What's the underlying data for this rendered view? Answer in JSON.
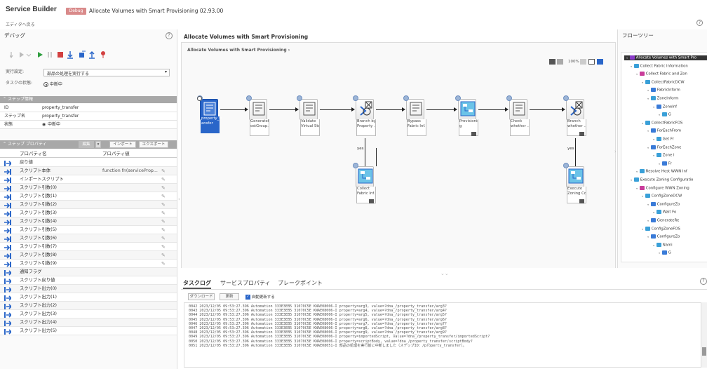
{
  "header": {
    "app_title": "Service Builder",
    "badge": "Debug",
    "title": "Allocate Volumes with Smart Provisioning 02.93.00",
    "back_link": "エディタへ戻る",
    "help": "?"
  },
  "left": {
    "title": "デバッグ",
    "help": "?",
    "exec_label": "実行設定:",
    "exec_value": "部品の処理を実行する",
    "status_label": "タスクの状態:",
    "status_value": "中断中",
    "step_section": "ステップ情報",
    "info": [
      {
        "k": "ID",
        "v": "property_transfer"
      },
      {
        "k": "ステップ名",
        "v": "property_transfer"
      },
      {
        "k": "状態",
        "v": "中断中"
      }
    ],
    "prop_section": "ステップ プロパティ",
    "prop_buttons": [
      "編集",
      "インポート",
      "エクスポート"
    ],
    "col_name": "プロパティ名",
    "col_value": "プロパティ値",
    "props": [
      {
        "n": "戻り値",
        "v": "",
        "icon": "out"
      },
      {
        "n": "スクリプト本体",
        "v": "function fn(serviceProp...",
        "icon": "in"
      },
      {
        "n": "インポートスクリプト",
        "v": "",
        "icon": "in"
      },
      {
        "n": "スクリプト引数(0)",
        "v": "",
        "icon": "in"
      },
      {
        "n": "スクリプト引数(1)",
        "v": "",
        "icon": "in"
      },
      {
        "n": "スクリプト引数(2)",
        "v": "",
        "icon": "in"
      },
      {
        "n": "スクリプト引数(3)",
        "v": "",
        "icon": "in"
      },
      {
        "n": "スクリプト引数(4)",
        "v": "",
        "icon": "in"
      },
      {
        "n": "スクリプト引数(5)",
        "v": "",
        "icon": "in"
      },
      {
        "n": "スクリプト引数(6)",
        "v": "",
        "icon": "in"
      },
      {
        "n": "スクリプト引数(7)",
        "v": "",
        "icon": "in"
      },
      {
        "n": "スクリプト引数(8)",
        "v": "",
        "icon": "in"
      },
      {
        "n": "スクリプト引数(9)",
        "v": "",
        "icon": "in"
      },
      {
        "n": "通知フラグ",
        "v": "",
        "icon": "out"
      },
      {
        "n": "スクリプト戻り値",
        "v": "",
        "icon": "out"
      },
      {
        "n": "スクリプト出力(0)",
        "v": "",
        "icon": "out"
      },
      {
        "n": "スクリプト出力(1)",
        "v": "",
        "icon": "out"
      },
      {
        "n": "スクリプト出力(2)",
        "v": "",
        "icon": "out"
      },
      {
        "n": "スクリプト出力(3)",
        "v": "",
        "icon": "out"
      },
      {
        "n": "スクリプト出力(4)",
        "v": "",
        "icon": "out"
      },
      {
        "n": "スクリプト出力(5)",
        "v": "",
        "icon": "out"
      }
    ]
  },
  "flow": {
    "title": "Allocate Volumes with Smart Provisioning",
    "breadcrumb": "Allocate Volumes with Smart Provisioning",
    "zoom": "100%",
    "nodes": [
      "property_tr\nansfer",
      "GenerateH\nostGroup...",
      "Validate\nVirtual Sto...",
      "Branch by\nProperty ...",
      "Bypass\nFabric Inf...",
      "Provisionin\ng",
      "Check\nwhether ...",
      "Branch\nwhether ..."
    ],
    "sub_nodes": [
      "Collect\nFabric Inf...",
      "Execute\nZoning Co..."
    ],
    "yes": "yes"
  },
  "tabs": {
    "items": [
      "タスクログ",
      "サービスプロパティ",
      "ブレークポイント"
    ],
    "download": "ダウンロード",
    "refresh": "更新",
    "auto_refresh": "自動更新する",
    "logs": [
      "0042 2023/12/05 09:53:27.396   Automation   333E3EB5 31070C5E KNAE08006-I     property=arg3, value=?dna_/property_transfer/arg3?",
      "0043 2023/12/05 09:53:27.396   Automation   333E3EB5 31070C5E KNAE08006-I     property=arg4, value=?dna_/property_transfer/arg4?",
      "0044 2023/12/05 09:53:27.396   Automation   333E3EB5 31070C5E KNAE08006-I     property=arg5, value=?dna_/property_transfer/arg5?",
      "0045 2023/12/05 09:53:27.396   Automation   333E3EB5 31070C5E KNAE08006-I     property=arg6, value=?dna_/property_transfer/arg6?",
      "0046 2023/12/05 09:53:27.396   Automation   333E3EB5 31070C5E KNAE08006-I     property=arg7, value=?dna_/property_transfer/arg7?",
      "0047 2023/12/05 09:53:27.396   Automation   333E3EB5 31070C5E KNAE08006-I     property=arg8, value=?dna_/property_transfer/arg8?",
      "0048 2023/12/05 09:53:27.396   Automation   333E3EB5 31070C5E KNAE08006-I     property=arg9, value=?dna_/property_transfer/arg9?",
      "0049 2023/12/05 09:53:27.396   Automation   333E3EB5 31070C5E KNAE08006-I     property=importedScript, value=?dna_/property_transfer/importedScript?",
      "0050 2023/12/05 09:53:27.396   Automation   333E3EB5 31070C5E KNAE08006-I     property=scriptBody, value=?dna_/property_transfer/scriptBody?",
      "0051 2023/12/05 09:53:27.396   Automation   333E3EB5 31070C5E KNAE08051-I     部品の処理を実行前に中断しました（ステップID：/property_transfer）。"
    ]
  },
  "tree": {
    "title": "フローツリー",
    "items": [
      {
        "t": "Allocate Volumes with Smart Pro",
        "d": 0,
        "c": "#8a3cc9",
        "sel": true
      },
      {
        "t": "Collect Fabric Information",
        "d": 1,
        "c": "#3aa0d8"
      },
      {
        "t": "Collect Fabric and Zon",
        "d": 2,
        "c": "#c93c9a"
      },
      {
        "t": "CollectFabricDCW",
        "d": 3,
        "c": "#3aa0d8"
      },
      {
        "t": "FabricInform",
        "d": 4,
        "c": "#3a7bd8"
      },
      {
        "t": "ZoneInform",
        "d": 4,
        "c": "#3aa0d8"
      },
      {
        "t": "ZoneInf",
        "d": 5,
        "c": "#3a7bd8"
      },
      {
        "t": "G",
        "d": 6,
        "c": "#3aa0d8"
      },
      {
        "t": "CollectFabricFOS",
        "d": 3,
        "c": "#3aa0d8"
      },
      {
        "t": "ForEachFrom",
        "d": 4,
        "c": "#3a7bd8"
      },
      {
        "t": "Get Fr",
        "d": 5,
        "c": "#3aa0d8"
      },
      {
        "t": "ForEachZone",
        "d": 4,
        "c": "#3a7bd8"
      },
      {
        "t": "Zone I",
        "d": 5,
        "c": "#3aa0d8"
      },
      {
        "t": "Fr",
        "d": 6,
        "c": "#3a7bd8"
      },
      {
        "t": "Resolve Host WWN Inf",
        "d": 2,
        "c": "#3aa0d8"
      },
      {
        "t": "Execute Zoning Configuratio",
        "d": 1,
        "c": "#3aa0d8"
      },
      {
        "t": "Configure WWN Zoning",
        "d": 2,
        "c": "#c93c9a"
      },
      {
        "t": "ConfigZoneDCW",
        "d": 3,
        "c": "#3aa0d8"
      },
      {
        "t": "ConfigureZo",
        "d": 4,
        "c": "#3a7bd8"
      },
      {
        "t": "Wait Fo",
        "d": 5,
        "c": "#3aa0d8"
      },
      {
        "t": "GenerateRe",
        "d": 4,
        "c": "#3a7bd8"
      },
      {
        "t": "ConfigZoneFOS",
        "d": 3,
        "c": "#3aa0d8"
      },
      {
        "t": "ConfigureZo",
        "d": 4,
        "c": "#3a7bd8"
      },
      {
        "t": "Nami",
        "d": 5,
        "c": "#3aa0d8"
      },
      {
        "t": "G",
        "d": 6,
        "c": "#3a7bd8"
      }
    ]
  }
}
